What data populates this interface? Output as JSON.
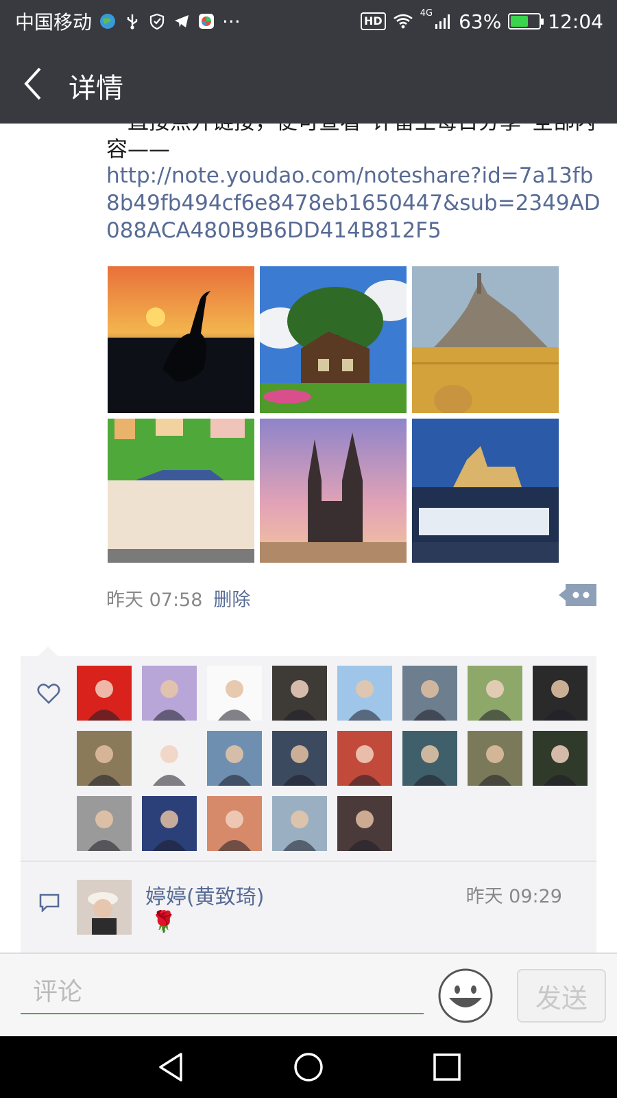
{
  "status_bar": {
    "carrier": "中国移动",
    "more": "···",
    "hd": "HD",
    "network": "4G",
    "battery_percent_text": "63%",
    "battery_level": 0.63,
    "time": "12:04"
  },
  "header": {
    "title": "详情"
  },
  "post": {
    "text": "一直接点开链接，便可查看“评留王每日分享”全部内容——",
    "link": "http://note.youdao.com/noteshare?id=7a13fb8b49fb494cf6e8478eb1650447&sub=2349AD088ACA480B9B6DD414B812F5",
    "photos": [
      "crane-sunset-photo",
      "cottage-photo",
      "mont-saint-michel-photo",
      "colorful-buildings-photo",
      "gothic-church-photo",
      "prague-castle-photo"
    ],
    "time": "昨天 07:58",
    "delete_label": "删除"
  },
  "likes": {
    "count": 21
  },
  "comments": [
    {
      "name": "婷婷(黄致琦)",
      "time": "昨天 09:29",
      "text": "🌹"
    }
  ],
  "input": {
    "placeholder": "评论",
    "send_label": "发送"
  },
  "colors": {
    "bar_bg": "#393a3f",
    "link": "#576b95",
    "accent_green": "#3ab34a"
  }
}
